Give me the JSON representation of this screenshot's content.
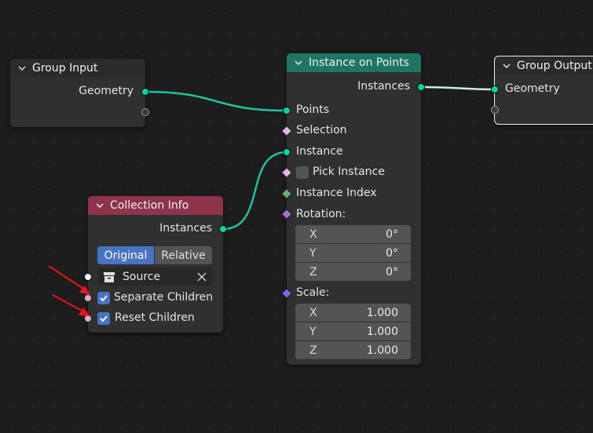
{
  "nodes": {
    "group_input": {
      "title": "Group Input",
      "outputs": [
        "Geometry"
      ]
    },
    "instance_on_points": {
      "title": "Instance on Points",
      "header_color": "#1e7563",
      "output": "Instances",
      "inputs": {
        "points": "Points",
        "selection": "Selection",
        "instance": "Instance",
        "pick_instance": "Pick Instance",
        "instance_index": "Instance Index",
        "rotation": "Rotation:",
        "scale": "Scale:"
      },
      "rotation": [
        {
          "axis": "X",
          "value": "0°"
        },
        {
          "axis": "Y",
          "value": "0°"
        },
        {
          "axis": "Z",
          "value": "0°"
        }
      ],
      "scale": [
        {
          "axis": "X",
          "value": "1.000"
        },
        {
          "axis": "Y",
          "value": "1.000"
        },
        {
          "axis": "Z",
          "value": "1.000"
        }
      ]
    },
    "group_output": {
      "title": "Group Output",
      "inputs": [
        "Geometry"
      ]
    },
    "collection_info": {
      "title": "Collection Info",
      "header_color": "#8e3349",
      "output": "Instances",
      "mode_options": [
        "Original",
        "Relative"
      ],
      "mode_selected": "Original",
      "collection_value": "Source",
      "separate_children": "Separate Children",
      "reset_children": "Reset Children"
    }
  },
  "colors": {
    "geometry_socket": "#00d6a3",
    "checkbox_on": "#4872c4",
    "annotation_arrow": "#e8141c"
  }
}
